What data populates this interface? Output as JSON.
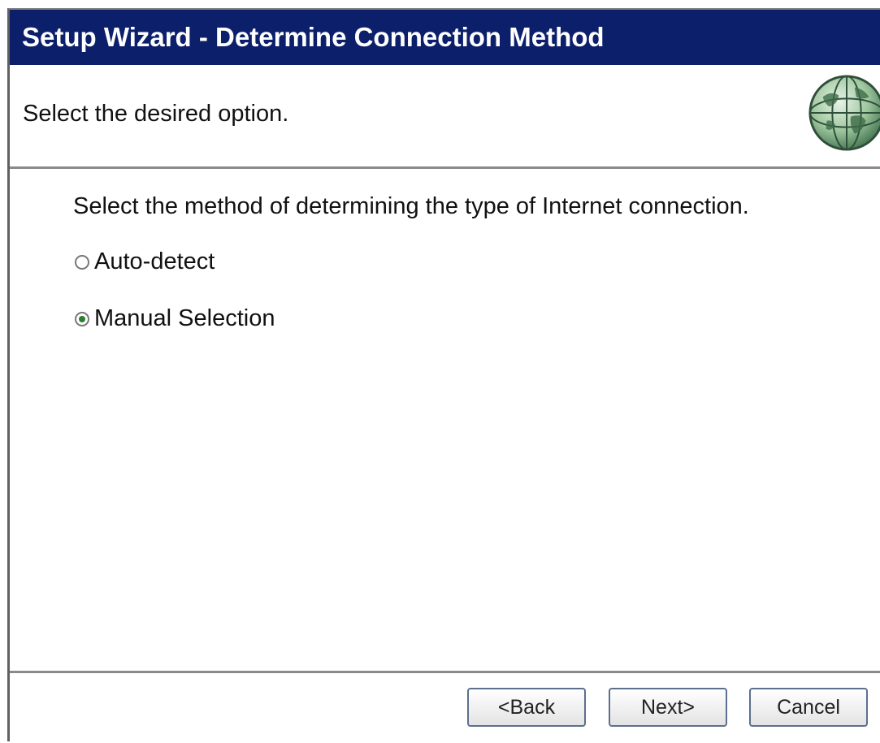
{
  "window": {
    "title": "Setup Wizard - Determine Connection Method"
  },
  "header": {
    "text": "Select the desired option.",
    "icon": "globe-icon"
  },
  "content": {
    "instruction": "Select the method of determining the type of Internet connection.",
    "options": [
      {
        "label": "Auto-detect",
        "selected": false
      },
      {
        "label": "Manual Selection",
        "selected": true
      }
    ]
  },
  "buttons": {
    "back": "<Back",
    "next": "Next>",
    "cancel": "Cancel"
  },
  "colors": {
    "title_bar": "#0c1f6b",
    "radio_selected": "#2e7d32"
  }
}
